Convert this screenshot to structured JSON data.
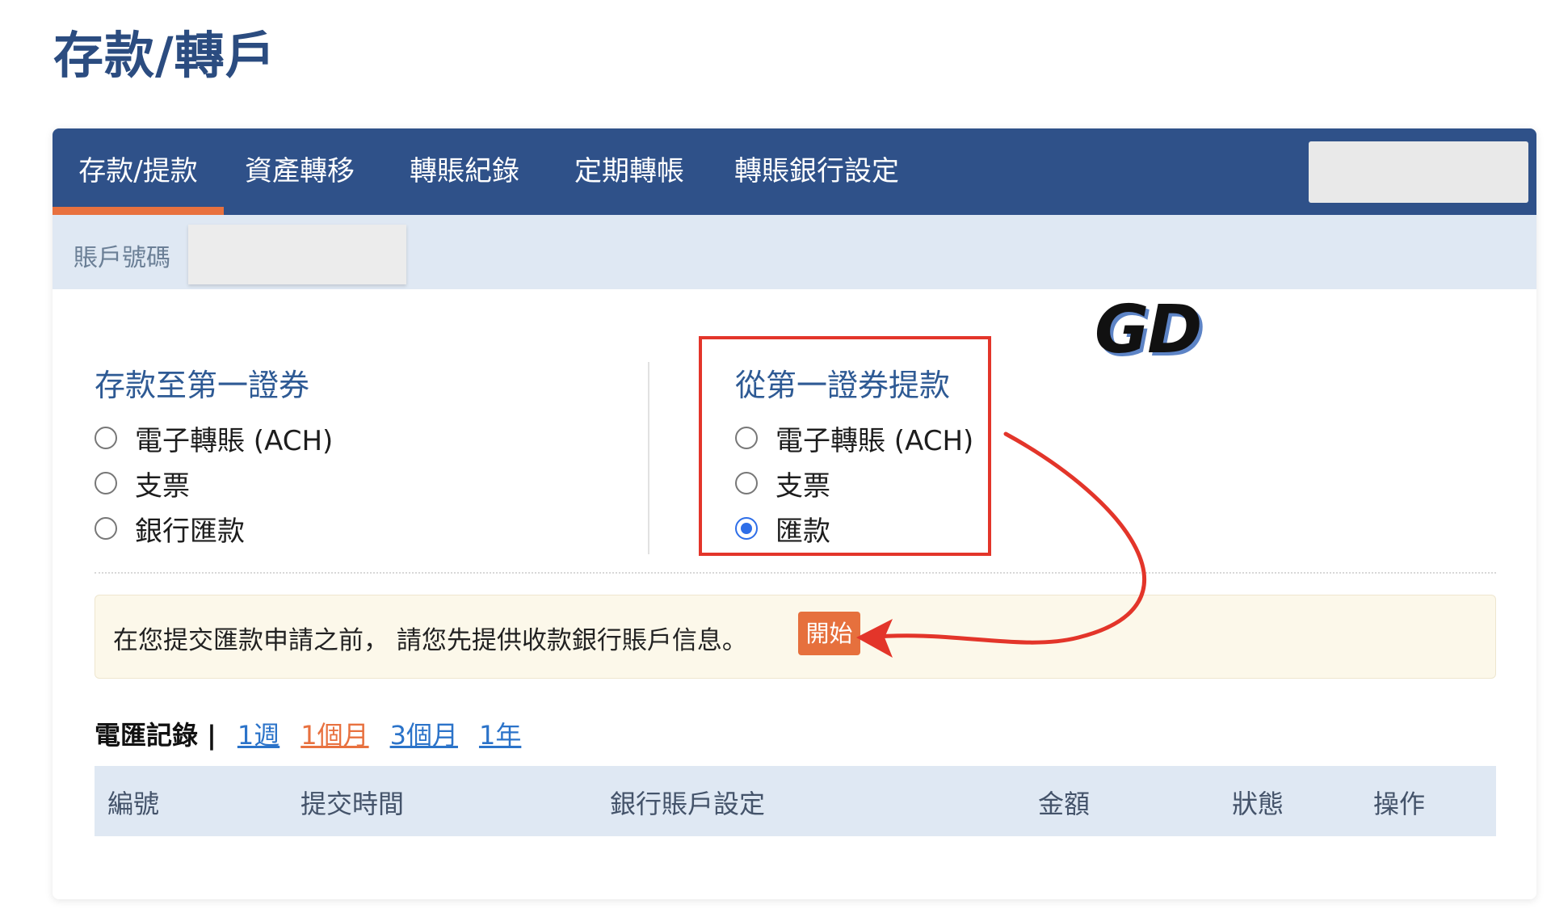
{
  "page": {
    "title": "存款/轉戶"
  },
  "tabs": [
    {
      "label": "存款/提款",
      "active": true
    },
    {
      "label": "資產轉移",
      "active": false
    },
    {
      "label": "轉賬紀錄",
      "active": false
    },
    {
      "label": "定期轉帳",
      "active": false
    },
    {
      "label": "轉賬銀行設定",
      "active": false
    }
  ],
  "account": {
    "label": "賬戶號碼"
  },
  "watermark": {
    "text": "GD"
  },
  "deposit": {
    "title": "存款至第一證券",
    "options": [
      {
        "label": "電子轉賬 (ACH)",
        "checked": false
      },
      {
        "label": "支票",
        "checked": false
      },
      {
        "label": "銀行匯款",
        "checked": false
      }
    ]
  },
  "withdraw": {
    "title": "從第一證券提款",
    "options": [
      {
        "label": "電子轉賬 (ACH)",
        "checked": false
      },
      {
        "label": "支票",
        "checked": false
      },
      {
        "label": "匯款",
        "checked": true
      }
    ]
  },
  "notice": {
    "text": "在您提交匯款申請之前， 請您先提供收款銀行賬戶信息。",
    "button_label": "開始"
  },
  "history": {
    "title": "電匯記錄 |",
    "ranges": [
      {
        "label": "1週",
        "active": false
      },
      {
        "label": "1個月",
        "active": true
      },
      {
        "label": "3個月",
        "active": false
      },
      {
        "label": "1年",
        "active": false
      }
    ]
  },
  "table": {
    "headers": [
      "編號",
      "提交時間",
      "銀行賬戶設定",
      "金額",
      "狀態",
      "操作"
    ]
  },
  "colors": {
    "nav_bg": "#2f5189",
    "active_accent": "#e8713f",
    "annotation_red": "#e3352a",
    "link_blue": "#2b73c9"
  }
}
